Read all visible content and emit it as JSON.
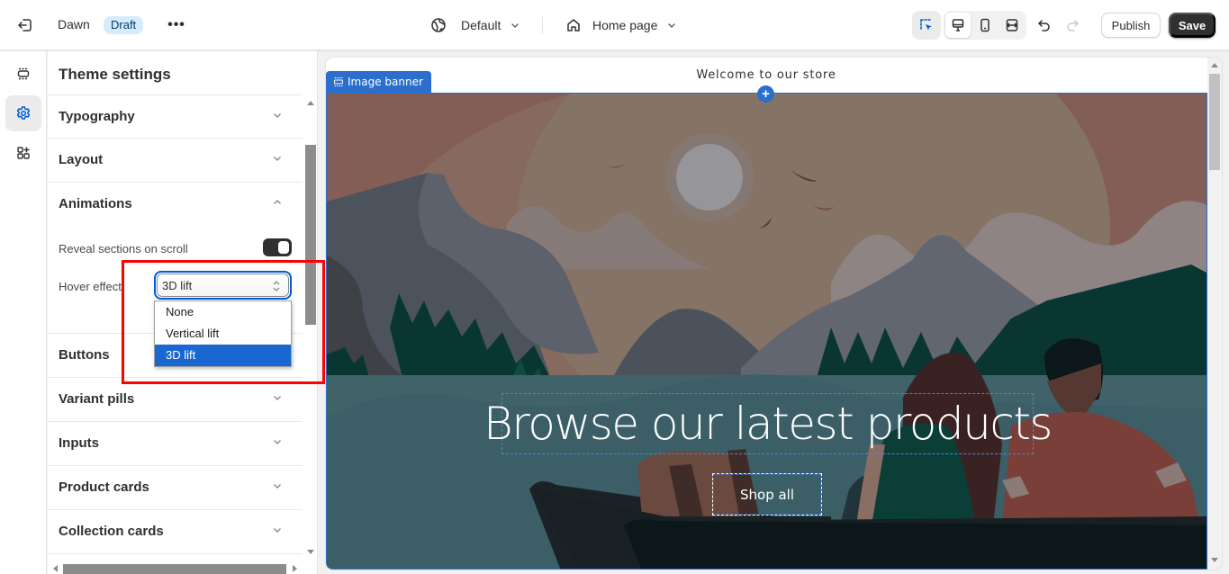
{
  "topbar": {
    "exit_icon": "exit-icon",
    "theme_name": "Dawn",
    "status_badge": "Draft",
    "more_label": "•••",
    "theme_selector": {
      "icon": "globe-icon",
      "label": "Default"
    },
    "page_selector": {
      "icon": "home-icon",
      "label": "Home page"
    },
    "tools": {
      "inspector": "select-inspector-icon",
      "desktop": "desktop-icon",
      "mobile": "mobile-icon",
      "fullwidth": "full-width-icon",
      "undo": "undo-icon",
      "redo": "redo-icon"
    },
    "publish_label": "Publish",
    "save_label": "Save"
  },
  "rail": {
    "items": [
      {
        "name": "sections",
        "icon": "sections-icon",
        "active": false
      },
      {
        "name": "theme-settings",
        "icon": "gear-icon",
        "active": true
      },
      {
        "name": "apps",
        "icon": "add-apps-icon",
        "active": false
      }
    ]
  },
  "sidebar": {
    "title": "Theme settings",
    "sections": [
      {
        "label": "Typography",
        "expanded": false
      },
      {
        "label": "Layout",
        "expanded": false
      },
      {
        "label": "Animations",
        "expanded": true
      },
      {
        "label": "Buttons",
        "expanded": false
      },
      {
        "label": "Variant pills",
        "expanded": false
      },
      {
        "label": "Inputs",
        "expanded": false
      },
      {
        "label": "Product cards",
        "expanded": false
      },
      {
        "label": "Collection cards",
        "expanded": false
      }
    ],
    "animations": {
      "reveal_label": "Reveal sections on scroll",
      "reveal_on": true,
      "hover_label": "Hover effect",
      "hover_value": "3D lift",
      "hover_options": [
        "None",
        "Vertical lift",
        "3D lift"
      ],
      "hover_selected_index": 2
    }
  },
  "preview": {
    "announcement": "Welcome to our store",
    "section_tab": {
      "icon": "section-icon",
      "label": "Image banner"
    },
    "add_section_label": "+",
    "headline": "Browse our latest products",
    "button_label": "Shop all"
  },
  "colors": {
    "accent": "#2c6ecb",
    "select_focus": "#005bd3",
    "dropdown_selected": "#1a67d2",
    "save_bg": "#303030",
    "badge_bg": "#d5ebff",
    "highlight": "#ff0000"
  }
}
